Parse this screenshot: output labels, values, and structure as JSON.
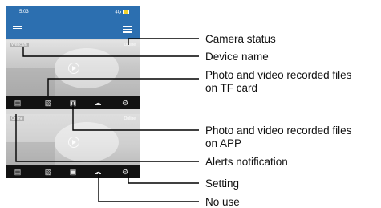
{
  "phone": {
    "time": "5:03",
    "network": "4G",
    "camera1": {
      "name": "Webcam",
      "status": "Online"
    },
    "camera2": {
      "name": "Online",
      "status": "Online"
    }
  },
  "callouts": {
    "camera_status": "Camera status",
    "device_name": "Device name",
    "tf_card_line1": "Photo and video recorded files",
    "tf_card_line2": "on TF card",
    "app_line1": "Photo and video recorded files",
    "app_line2": "on APP",
    "alerts": "Alerts notification",
    "setting": "Setting",
    "no_use": "No use"
  },
  "colors": {
    "app_bar": "#2c6fb0",
    "toolbar": "#121212"
  },
  "icons": [
    "alerts-icon",
    "tf-card-files-icon",
    "app-files-icon",
    "weather-icon",
    "settings-icon"
  ]
}
